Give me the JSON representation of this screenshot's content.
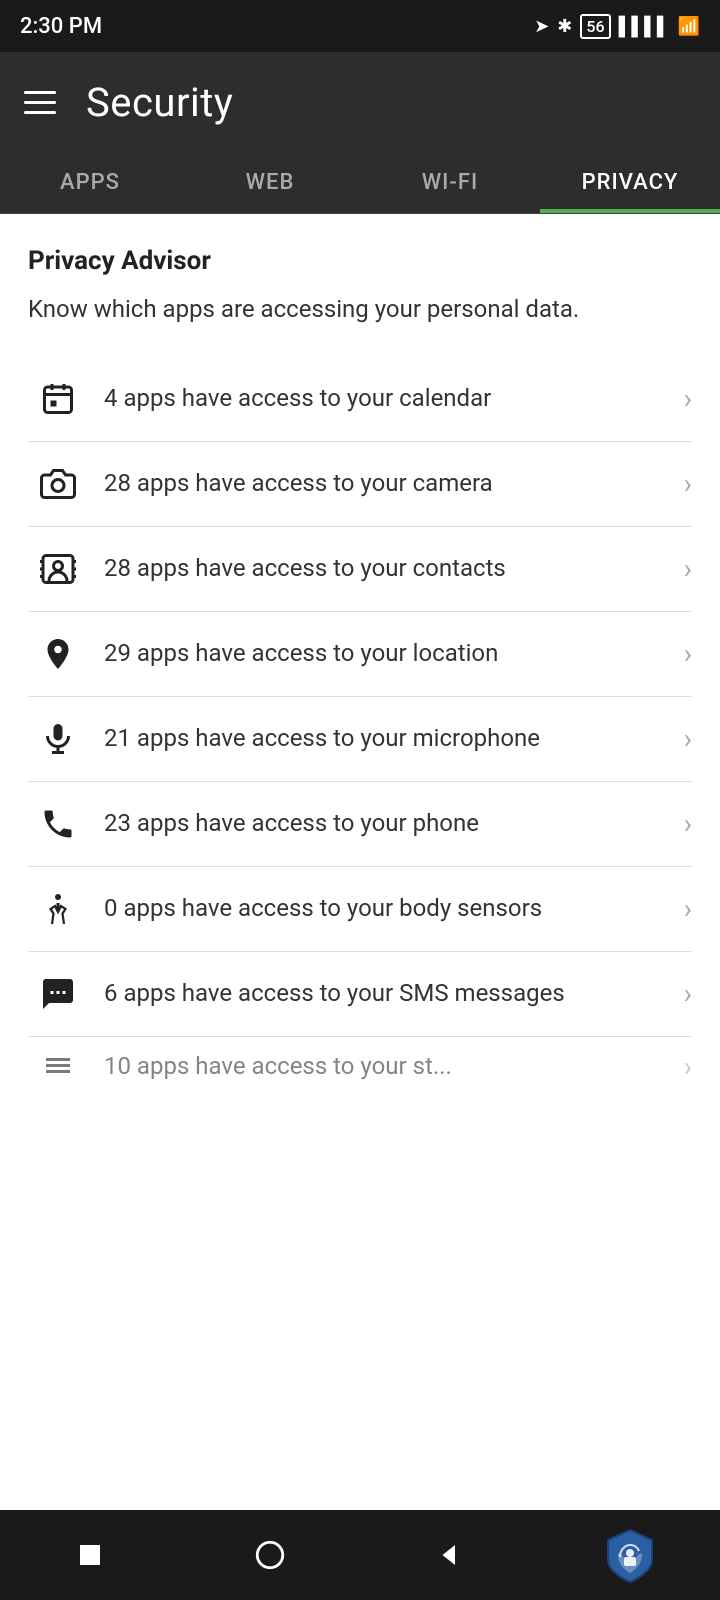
{
  "statusBar": {
    "time": "2:30 PM",
    "battery": "56"
  },
  "header": {
    "title": "Security"
  },
  "tabs": [
    {
      "id": "apps",
      "label": "APPS",
      "active": false
    },
    {
      "id": "web",
      "label": "WEB",
      "active": false
    },
    {
      "id": "wifi",
      "label": "WI-FI",
      "active": false
    },
    {
      "id": "privacy",
      "label": "PRIVACY",
      "active": true
    }
  ],
  "privacyAdvisor": {
    "title": "Privacy Advisor",
    "description": "Know which apps are accessing your personal data."
  },
  "privacyItems": [
    {
      "id": "calendar",
      "icon": "calendar",
      "text": "4 apps have access to your calendar"
    },
    {
      "id": "camera",
      "icon": "camera",
      "text": "28 apps have access to your camera"
    },
    {
      "id": "contacts",
      "icon": "contacts",
      "text": "28 apps have access to your contacts"
    },
    {
      "id": "location",
      "icon": "location",
      "text": "29 apps have access to your location"
    },
    {
      "id": "microphone",
      "icon": "microphone",
      "text": "21 apps have access to your microphone"
    },
    {
      "id": "phone",
      "icon": "phone",
      "text": "23 apps have access to your phone"
    },
    {
      "id": "body-sensors",
      "icon": "body",
      "text": "0 apps have access to your body sensors"
    },
    {
      "id": "sms",
      "icon": "sms",
      "text": "6 apps have access to your SMS messages"
    },
    {
      "id": "storage",
      "icon": "storage",
      "text": "10 apps have access to your st..."
    }
  ],
  "bottomNav": {
    "stop": "■",
    "home": "○",
    "back": "◄"
  }
}
